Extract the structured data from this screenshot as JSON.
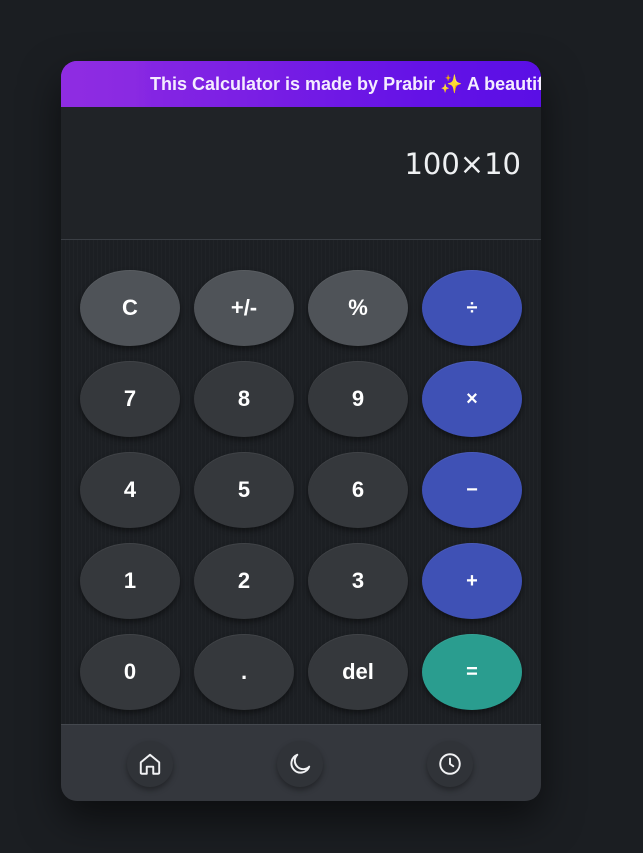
{
  "banner": {
    "text": "This Calculator is made by Prabir ✨ A beautiful calculator"
  },
  "display": {
    "value": "100×10"
  },
  "keys": {
    "clear": "C",
    "sign": "+/-",
    "percent": "%",
    "divide": "÷",
    "seven": "7",
    "eight": "8",
    "nine": "9",
    "multiply": "×",
    "four": "4",
    "five": "5",
    "six": "6",
    "minus": "−",
    "one": "1",
    "two": "2",
    "three": "3",
    "plus": "+",
    "zero": "0",
    "dot": ".",
    "del": "del",
    "equals": "="
  },
  "footer": {
    "items": [
      {
        "icon": "home-icon"
      },
      {
        "icon": "moon-icon"
      },
      {
        "icon": "clock-icon"
      }
    ]
  },
  "colors": {
    "accent_operator": "#3f51b5",
    "accent_equals": "#2a9d8f",
    "banner_start": "#8e2be2",
    "banner_end": "#5a0fe5"
  }
}
